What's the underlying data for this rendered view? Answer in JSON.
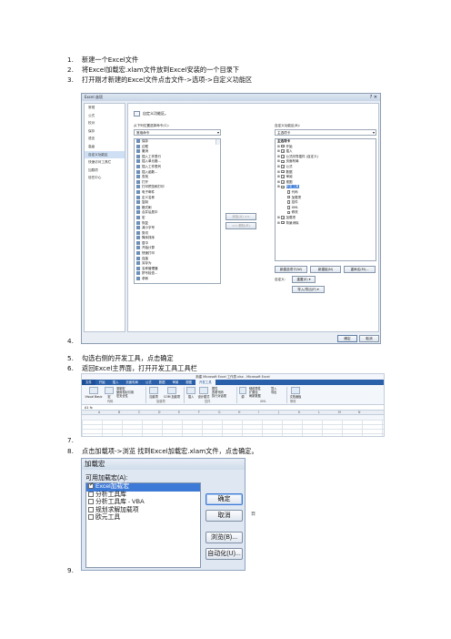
{
  "steps": [
    {
      "num": "1.",
      "text": "新建一个Excel文件"
    },
    {
      "num": "2.",
      "text": "将Excel加载宏.xlam文件放到Excel安装的一个目录下"
    },
    {
      "num": "3.",
      "text": "打开刚才新建的Excel文件点击文件->选项->自定义功能区"
    },
    {
      "num": "4.",
      "text": ""
    },
    {
      "num": "5.",
      "text": "勾选右侧的开发工具，点击确定"
    },
    {
      "num": "6.",
      "text": "返回Excel主界面，打开开发工具工具栏"
    },
    {
      "num": "7.",
      "text": ""
    },
    {
      "num": "8.",
      "text": "点击加载项->浏览  找到Excel加载宏.xlam文件，点击确定。"
    },
    {
      "num": "9.",
      "text": ""
    }
  ],
  "options_dialog": {
    "title": "Excel 选项",
    "close": "?  ✕",
    "nav": [
      "常规",
      "公式",
      "校对",
      "保存",
      "语言",
      "高级",
      "自定义功能区",
      "快速访问工具栏",
      "加载项",
      "信任中心"
    ],
    "nav_selected": 6,
    "heading": "自定义功能区。",
    "choose_label": "从下列位置选择命令(C):",
    "choose_value": "常用命令",
    "customize_label": "自定义功能区(B):",
    "customize_value": "主选项卡",
    "commands": [
      "保存",
      "边框",
      "撤消",
      "插入工作表行",
      "插入单元格...",
      "插入工作表列",
      "插入函数...",
      "查找",
      "打开",
      "打印预览和打印",
      "电子邮件",
      "定义名称",
      "复制",
      "格式刷",
      "合并后居中",
      "宏",
      "恢复",
      "减小字号",
      "剪切",
      "降序排序",
      "居中",
      "开始计算",
      "快速打印",
      "连接",
      "另存为",
      "名称管理器",
      "拼写检查...",
      "求和"
    ],
    "tabs_header": "主选项卡",
    "tabs": [
      {
        "label": "开始",
        "checked": true,
        "indent": 0
      },
      {
        "label": "插入",
        "checked": true,
        "indent": 0
      },
      {
        "label": "公式向导插件 (自定义)",
        "checked": true,
        "indent": 0
      },
      {
        "label": "页面布局",
        "checked": true,
        "indent": 0
      },
      {
        "label": "公式",
        "checked": true,
        "indent": 0
      },
      {
        "label": "数据",
        "checked": true,
        "indent": 0
      },
      {
        "label": "审阅",
        "checked": true,
        "indent": 0
      },
      {
        "label": "视图",
        "checked": true,
        "indent": 0
      },
      {
        "label": "开发工具",
        "checked": true,
        "indent": 0,
        "highlight": true
      },
      {
        "label": "代码",
        "checked": false,
        "indent": 1
      },
      {
        "label": "加载项",
        "checked": false,
        "indent": 1
      },
      {
        "label": "控件",
        "checked": false,
        "indent": 1
      },
      {
        "label": "XML",
        "checked": false,
        "indent": 1
      },
      {
        "label": "修改",
        "checked": false,
        "indent": 1
      },
      {
        "label": "加载项",
        "checked": true,
        "indent": 0
      },
      {
        "label": "背景消除",
        "checked": true,
        "indent": 0
      }
    ],
    "add_button": "添加(A) >>",
    "remove_button": "<< 删除(R)",
    "new_tab": "新建选项卡(W)",
    "new_group": "新建组(N)",
    "rename": "重命名(M)...",
    "customize_label2": "自定义:",
    "reset": "重置(E) ▾",
    "import_export": "导入/导出(P) ▾",
    "ok": "确定",
    "cancel": "取消"
  },
  "excel_ribbon": {
    "window_title": "新建 Microsoft Excel 工作表.xlsx - Microsoft Excel",
    "tabs": [
      "文件",
      "开始",
      "插入",
      "页面布局",
      "公式",
      "数据",
      "审阅",
      "视图",
      "开发工具"
    ],
    "active_tab": "开发工具",
    "buttons": [
      "Visual Basic",
      "宏",
      "录制宏",
      "使用相对引用",
      "宏安全性",
      "加载项",
      "COM 加载项",
      "插入",
      "设计模式",
      "属性",
      "查看代码",
      "执行对话框",
      "源",
      "映射属性",
      "扩展包",
      "刷新数据",
      "导入",
      "导出",
      "文档面板"
    ],
    "groups": [
      "代码",
      "加载项",
      "控件",
      "XML",
      "修改"
    ],
    "name_box": "A1",
    "columns": [
      "A",
      "B",
      "C",
      "D",
      "E",
      "F",
      "G",
      "H",
      "I",
      "J",
      "K",
      "L",
      "M",
      "N"
    ]
  },
  "addins_dialog": {
    "title": "加载宏",
    "available_label": "可用加载宏(A):",
    "items": [
      {
        "label": "Excel加载宏",
        "checked": true,
        "highlight": true
      },
      {
        "label": "分析工具库",
        "checked": false
      },
      {
        "label": "分析工具库 - VBA",
        "checked": false
      },
      {
        "label": "规划求解加载项",
        "checked": false
      },
      {
        "label": "欧元工具",
        "checked": false
      }
    ],
    "ok": "确定",
    "cancel": "取消",
    "browse": "浏览(B)...",
    "automation": "自动化(U)...",
    "side_mark": "日"
  }
}
